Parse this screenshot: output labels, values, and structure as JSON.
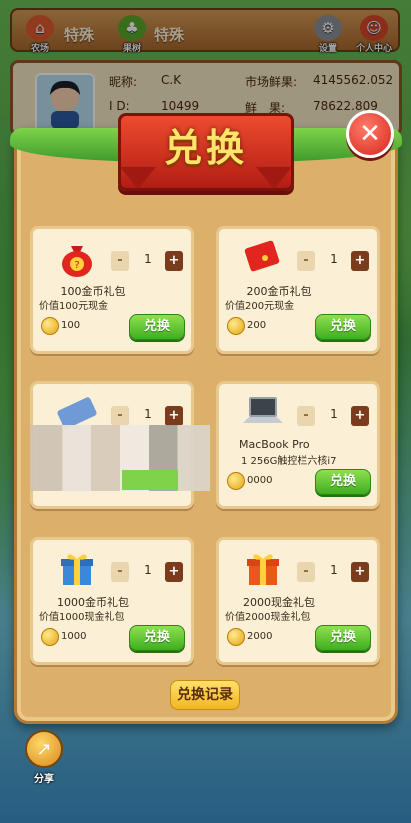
{
  "topbar": {
    "nav": [
      {
        "label": "农场",
        "icon": "house-icon"
      },
      {
        "label": "果树",
        "icon": "tree-icon"
      },
      {
        "label": "设置",
        "icon": "gear-icon"
      },
      {
        "label": "个人中心",
        "icon": "person-icon"
      }
    ],
    "left_text": "特殊",
    "mid_text": "特殊"
  },
  "player": {
    "nickname_label": "昵称:",
    "nickname": "C.K",
    "id_label": "I D:",
    "id": "10499",
    "market_label": "市场鲜果:",
    "market_value": "4145562.052",
    "fruit_label": "鲜　果:",
    "fruit_value": "78622.809"
  },
  "modal": {
    "title": "兑换",
    "close_icon": "close-icon",
    "records_label": "兑换记录"
  },
  "items": [
    {
      "name": "100金币礼包",
      "desc": "价值100元现金",
      "price": "100",
      "qty": "1",
      "button": "兑换",
      "icon": "money-bag-icon"
    },
    {
      "name": "200金币礼包",
      "desc": "价值200元现金",
      "price": "200",
      "qty": "1",
      "button": "兑换",
      "icon": "red-envelope-icon"
    },
    {
      "name": "",
      "desc": "",
      "price": "",
      "qty": "1",
      "button": "",
      "icon": "phone-icon"
    },
    {
      "name": "MacBook Pro",
      "desc": "1 256G触控栏六核i7",
      "price": "0000",
      "qty": "1",
      "button": "兑换",
      "icon": "laptop-icon"
    },
    {
      "name": "1000金币礼包",
      "desc": "价值1000现金礼包",
      "price": "1000",
      "qty": "1",
      "button": "兑换",
      "icon": "gift-box-blue-icon"
    },
    {
      "name": "2000现金礼包",
      "desc": "价值2000现金礼包",
      "price": "2000",
      "qty": "1",
      "button": "兑换",
      "icon": "gift-box-red-icon"
    }
  ],
  "share": {
    "label": "分享",
    "icon": "share-icon"
  },
  "colors": {
    "exchange_green": "#3fae20",
    "title_red": "#d6261b",
    "banner_text": "#ffe36b"
  }
}
